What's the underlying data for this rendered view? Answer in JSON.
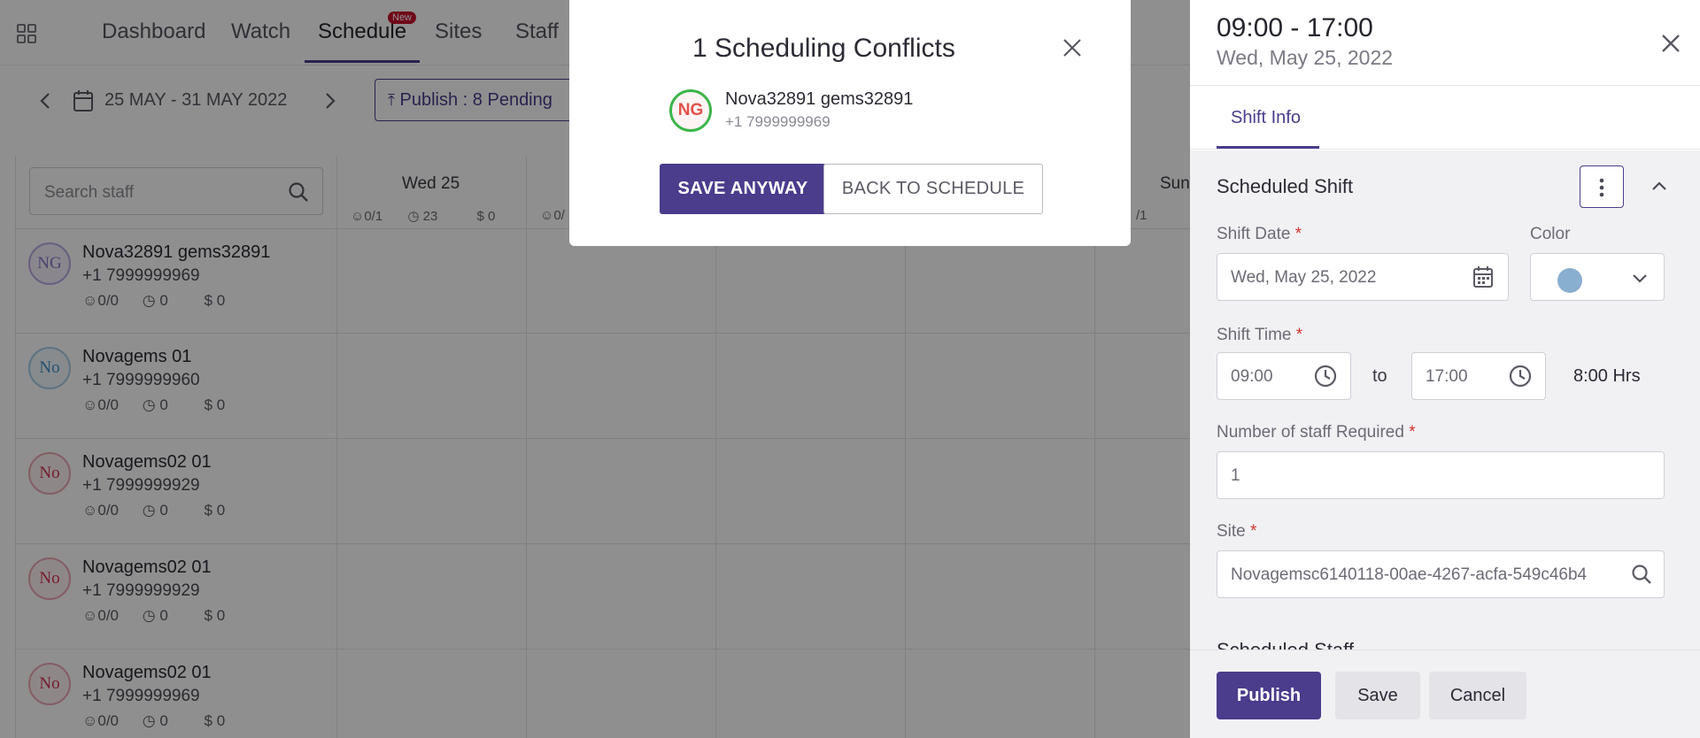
{
  "nav": {
    "items": [
      "Dashboard",
      "Watch",
      "Schedule",
      "Sites",
      "Staff"
    ],
    "active": "Schedule",
    "new_badge": "New"
  },
  "toolbar": {
    "date_range": "25 MAY - 31 MAY 2022",
    "publish_pending": "Publish : 8 Pending"
  },
  "grid": {
    "search_placeholder": "Search staff",
    "day_header": "Wed 25",
    "day_stats": {
      "staff": "0/1",
      "hours": "23",
      "cost": "$ 0"
    },
    "next_day_stats_partial": "0/",
    "partial_day_right": "Sun",
    "partial_stats_right": "/1",
    "staff": [
      {
        "initials": "NG",
        "name": "Nova32891 gems32891",
        "phone": "+1 7999999969",
        "assigned": "0/0",
        "hours": "0",
        "cost": "$ 0",
        "color": "#8a72c6"
      },
      {
        "initials": "No",
        "name": "Novagems 01",
        "phone": "+1 7999999960",
        "assigned": "0/0",
        "hours": "0",
        "cost": "$ 0",
        "color": "#3d8fc4"
      },
      {
        "initials": "No",
        "name": "Novagems02 01",
        "phone": "+1 7999999929",
        "assigned": "0/0",
        "hours": "0",
        "cost": "$ 0",
        "color": "#d0344f"
      },
      {
        "initials": "No",
        "name": "Novagems02 01",
        "phone": "+1 7999999929",
        "assigned": "0/0",
        "hours": "0",
        "cost": "$ 0",
        "color": "#d0344f"
      },
      {
        "initials": "No",
        "name": "Novagems02 01",
        "phone": "+1 7999999969",
        "assigned": "0/0",
        "hours": "0",
        "cost": "$ 0",
        "color": "#d0344f"
      }
    ]
  },
  "drawer": {
    "time": "09:00 - 17:00",
    "date": "Wed, May 25, 2022",
    "tab": "Shift Info",
    "section_title": "Scheduled Shift",
    "shift_date_label": "Shift Date",
    "shift_date_value": "Wed, May 25, 2022",
    "color_label": "Color",
    "color_value": "#88aed0",
    "shift_time_label": "Shift Time",
    "start_time": "09:00",
    "to": "to",
    "end_time": "17:00",
    "duration": "8:00 Hrs",
    "staff_required_label": "Number of staff Required",
    "staff_required_value": "1",
    "site_label": "Site",
    "site_value": "Novagemsc6140118-00ae-4267-acfa-549c46b4",
    "scheduled_staff_label": "Scheduled Staff",
    "required_mark": "*",
    "buttons": {
      "publish": "Publish",
      "save": "Save",
      "cancel": "Cancel"
    }
  },
  "modal": {
    "title": "1 Scheduling Conflicts",
    "conflict": {
      "initials": "NG",
      "name": "Nova32891 gems32891",
      "phone": "+1 7999999969"
    },
    "save_anyway": "SAVE ANYWAY",
    "back": "BACK TO SCHEDULE"
  },
  "colors": {
    "primary": "#4b3c8c",
    "overlay": "rgba(0,0,0,0.44)",
    "required": "#d0342c",
    "conflict_ring": "#3cb54a"
  }
}
